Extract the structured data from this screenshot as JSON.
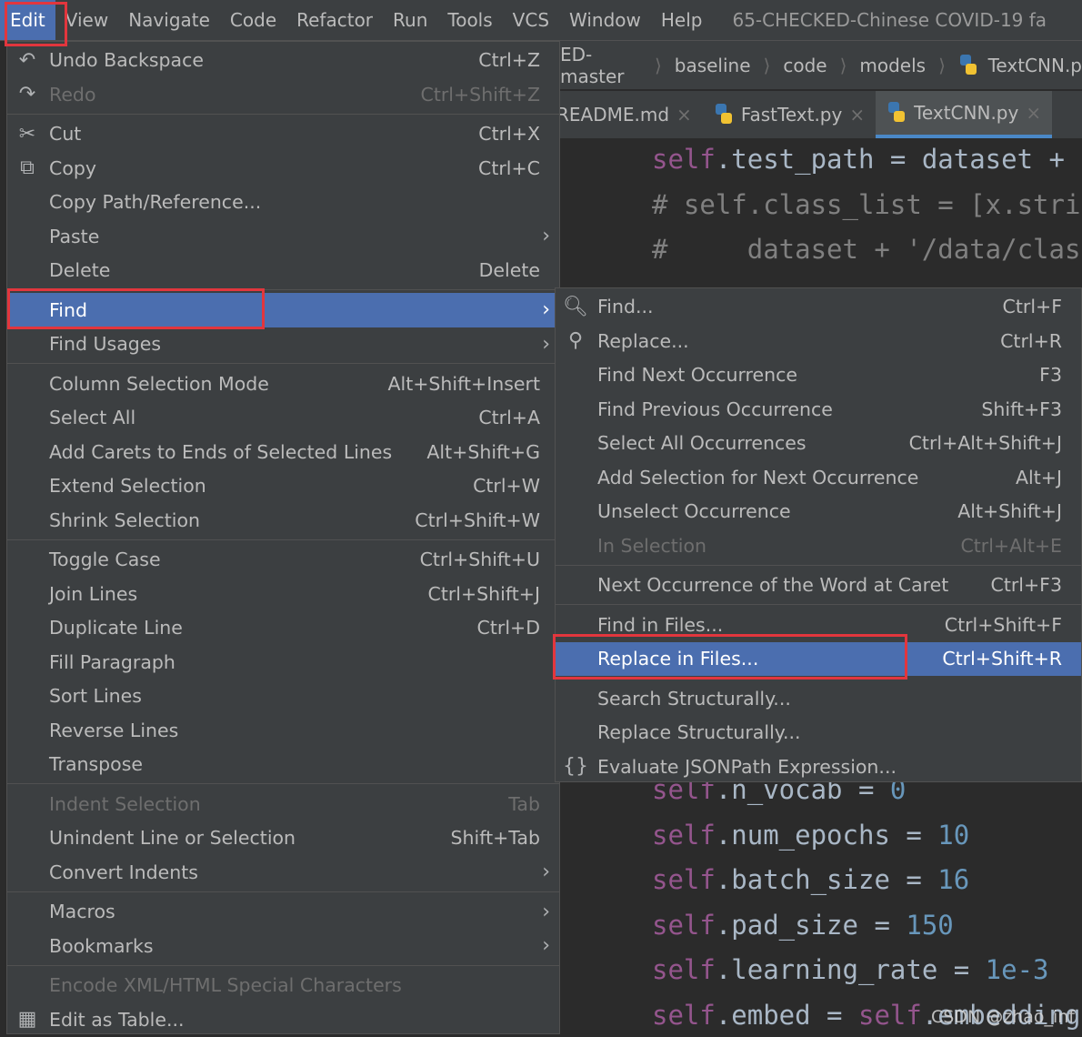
{
  "menubar": {
    "items": [
      "Edit",
      "View",
      "Navigate",
      "Code",
      "Refactor",
      "Run",
      "Tools",
      "VCS",
      "Window",
      "Help"
    ],
    "active": "Edit",
    "window_title": "65-CHECKED-Chinese COVID-19 fa"
  },
  "breadcrumb": [
    "ED-master",
    "baseline",
    "code",
    "models",
    "TextCNN.p"
  ],
  "tabs": [
    {
      "label": "README.md",
      "close": "×"
    },
    {
      "label": "FastText.py",
      "close": "×"
    },
    {
      "label": "TextCNN.py",
      "close": "×",
      "active": true
    }
  ],
  "code": {
    "top": [
      {
        "self": "self",
        "rest": ".test_path = dataset +"
      },
      {
        "comment": "# self.class_list = [x.stri"
      },
      {
        "comment": "#     dataset + '/data/clas"
      }
    ],
    "bottom": [
      {
        "self": "self",
        "rest": ".n_vocab = ",
        "num": "0"
      },
      {
        "self": "self",
        "rest": ".num_epochs = ",
        "num": "10"
      },
      {
        "self": "self",
        "rest": ".batch_size = ",
        "num": "16"
      },
      {
        "self": "self",
        "rest": ".pad_size = ",
        "num": "150"
      },
      {
        "self": "self",
        "rest": ".learning_rate = ",
        "num": "1e-3"
      },
      {
        "self": "self",
        "rest": ".embed = ",
        "self2": "self",
        "rest2": ".embedding"
      }
    ]
  },
  "edit_menu": {
    "items": [
      {
        "label": "Undo Backspace",
        "shortcut": "Ctrl+Z",
        "icon": "undo-icon"
      },
      {
        "label": "Redo",
        "shortcut": "Ctrl+Shift+Z",
        "icon": "redo-icon",
        "disabled": true
      },
      {
        "sep": true
      },
      {
        "label": "Cut",
        "shortcut": "Ctrl+X",
        "icon": "scissors-icon"
      },
      {
        "label": "Copy",
        "shortcut": "Ctrl+C",
        "icon": "copy-icon"
      },
      {
        "label": "Copy Path/Reference...",
        "shortcut": ""
      },
      {
        "label": "Paste",
        "submenu": true
      },
      {
        "label": "Delete",
        "shortcut": "Delete"
      },
      {
        "sep": true
      },
      {
        "label": "Find",
        "submenu": true,
        "highlighted": true
      },
      {
        "label": "Find Usages",
        "submenu": true
      },
      {
        "sep": true
      },
      {
        "label": "Column Selection Mode",
        "shortcut": "Alt+Shift+Insert"
      },
      {
        "label": "Select All",
        "shortcut": "Ctrl+A"
      },
      {
        "label": "Add Carets to Ends of Selected Lines",
        "shortcut": "Alt+Shift+G"
      },
      {
        "label": "Extend Selection",
        "shortcut": "Ctrl+W"
      },
      {
        "label": "Shrink Selection",
        "shortcut": "Ctrl+Shift+W"
      },
      {
        "sep": true
      },
      {
        "label": "Toggle Case",
        "shortcut": "Ctrl+Shift+U"
      },
      {
        "label": "Join Lines",
        "shortcut": "Ctrl+Shift+J"
      },
      {
        "label": "Duplicate Line",
        "shortcut": "Ctrl+D"
      },
      {
        "label": "Fill Paragraph",
        "shortcut": ""
      },
      {
        "label": "Sort Lines",
        "shortcut": ""
      },
      {
        "label": "Reverse Lines",
        "shortcut": ""
      },
      {
        "label": "Transpose",
        "shortcut": ""
      },
      {
        "sep": true
      },
      {
        "label": "Indent Selection",
        "shortcut": "Tab",
        "disabled": true
      },
      {
        "label": "Unindent Line or Selection",
        "shortcut": "Shift+Tab"
      },
      {
        "label": "Convert Indents",
        "submenu": true
      },
      {
        "sep": true
      },
      {
        "label": "Macros",
        "submenu": true
      },
      {
        "label": "Bookmarks",
        "submenu": true
      },
      {
        "sep": true
      },
      {
        "label": "Encode XML/HTML Special Characters",
        "shortcut": "",
        "disabled": true
      },
      {
        "label": "Edit as Table...",
        "shortcut": "",
        "icon": "table-icon"
      }
    ]
  },
  "find_submenu": {
    "items": [
      {
        "label": "Find...",
        "shortcut": "Ctrl+F",
        "icon": "search-icon"
      },
      {
        "label": "Replace...",
        "shortcut": "Ctrl+R",
        "icon": "replace-icon"
      },
      {
        "label": "Find Next Occurrence",
        "shortcut": "F3"
      },
      {
        "label": "Find Previous Occurrence",
        "shortcut": "Shift+F3"
      },
      {
        "label": "Select All Occurrences",
        "shortcut": "Ctrl+Alt+Shift+J"
      },
      {
        "label": "Add Selection for Next Occurrence",
        "shortcut": "Alt+J"
      },
      {
        "label": "Unselect Occurrence",
        "shortcut": "Alt+Shift+J"
      },
      {
        "label": "In Selection",
        "shortcut": "Ctrl+Alt+E",
        "disabled": true
      },
      {
        "sep": true
      },
      {
        "label": "Next Occurrence of the Word at Caret",
        "shortcut": "Ctrl+F3"
      },
      {
        "sep": true
      },
      {
        "label": "Find in Files...",
        "shortcut": "Ctrl+Shift+F"
      },
      {
        "label": "Replace in Files...",
        "shortcut": "Ctrl+Shift+R",
        "highlighted": true
      },
      {
        "sep": true,
        "invisible": true
      },
      {
        "label": "Search Structurally...",
        "shortcut": ""
      },
      {
        "label": "Replace Structurally...",
        "shortcut": ""
      },
      {
        "label": "Evaluate JSONPath Expression...",
        "shortcut": "",
        "icon": "jsonpath-icon"
      }
    ]
  },
  "icons": {
    "undo-icon": "↶",
    "redo-icon": "↷",
    "scissors-icon": "✂",
    "copy-icon": "⧉",
    "table-icon": "▦",
    "search-icon": "🔍︎",
    "replace-icon": "⚲",
    "jsonpath-icon": "{}",
    "submenu-arrow": "›"
  },
  "watermark": "CSDN @zhao_inf",
  "colors": {
    "highlight": "#4b6eaf",
    "annotation": "#e2363d",
    "background": "#3c3f41",
    "editor": "#2b2b2b"
  }
}
